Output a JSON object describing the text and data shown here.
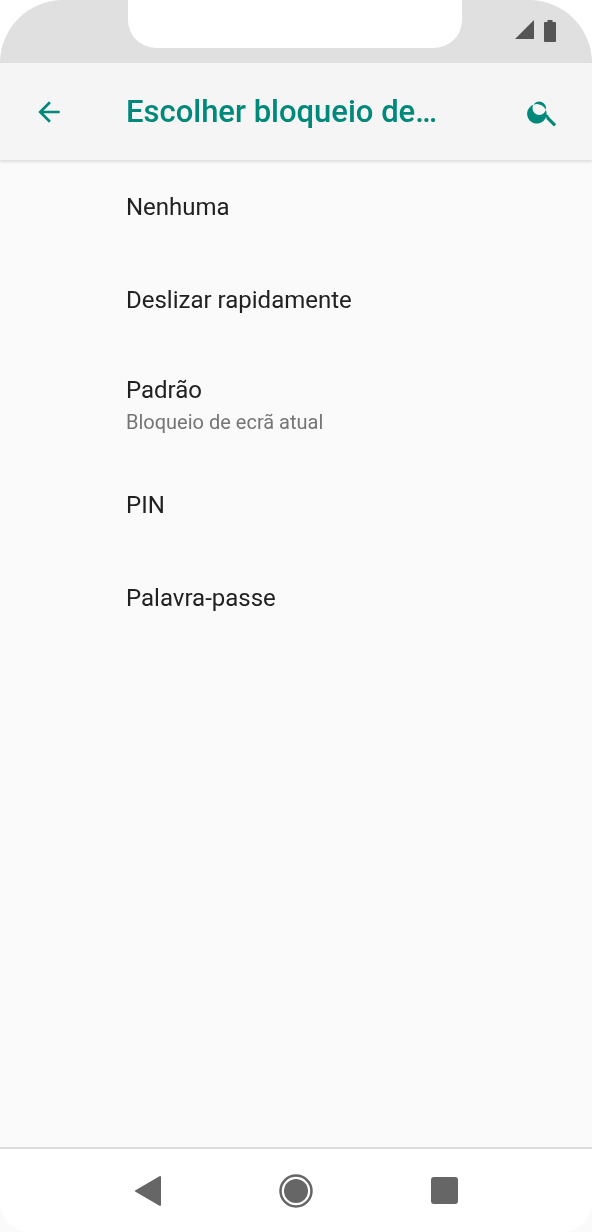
{
  "app_bar": {
    "title": "Escolher bloqueio de…"
  },
  "options": [
    {
      "title": "Nenhuma"
    },
    {
      "title": "Deslizar rapidamente"
    },
    {
      "title": "Padrão",
      "subtitle": "Bloqueio de ecrã atual"
    },
    {
      "title": "PIN"
    },
    {
      "title": "Palavra-passe"
    }
  ]
}
